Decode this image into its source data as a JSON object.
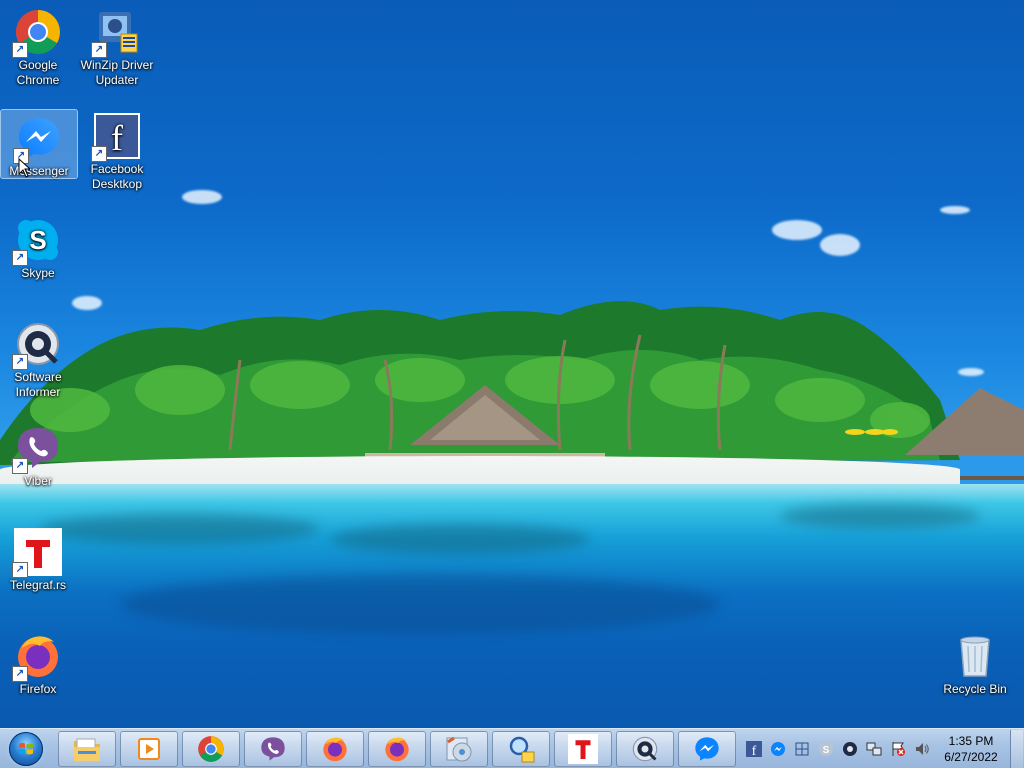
{
  "desktop": {
    "icons": [
      {
        "label_line1": "Google",
        "label_line2": "Chrome",
        "icon": "chrome-icon"
      },
      {
        "label_line1": "WinZip Driver",
        "label_line2": "Updater",
        "icon": "winzip-driver-updater-icon"
      },
      {
        "label_line1": "Messenger",
        "label_line2": "",
        "icon": "messenger-icon",
        "selected": true
      },
      {
        "label_line1": "Facebook",
        "label_line2": "Desktkop",
        "icon": "facebook-icon"
      },
      {
        "label_line1": "Skype",
        "label_line2": "",
        "icon": "skype-icon"
      },
      {
        "label_line1": "Software",
        "label_line2": "Informer",
        "icon": "software-informer-icon"
      },
      {
        "label_line1": "Viber",
        "label_line2": "",
        "icon": "viber-icon"
      },
      {
        "label_line1": "Telegraf.rs",
        "label_line2": "",
        "icon": "telegraf-icon"
      },
      {
        "label_line1": "Firefox",
        "label_line2": "",
        "icon": "firefox-icon"
      },
      {
        "label_line1": "Recycle Bin",
        "label_line2": "",
        "icon": "recycle-bin-icon"
      }
    ]
  },
  "taskbar": {
    "pinned": [
      {
        "name": "file-explorer-icon"
      },
      {
        "name": "media-player-icon"
      },
      {
        "name": "chrome-icon"
      },
      {
        "name": "viber-icon"
      },
      {
        "name": "firefox-icon"
      },
      {
        "name": "firefox-icon"
      },
      {
        "name": "disc-tool-icon"
      },
      {
        "name": "driver-updater-icon"
      },
      {
        "name": "telegraf-icon"
      },
      {
        "name": "software-informer-icon"
      },
      {
        "name": "messenger-icon"
      }
    ],
    "tray": {
      "icons": [
        "facebook-icon",
        "messenger-icon",
        "network-tool-icon",
        "skype-icon",
        "software-informer-icon",
        "network-icon",
        "flag-icon",
        "volume-icon"
      ],
      "time": "1:35 PM",
      "date": "6/27/2022"
    }
  },
  "colors": {
    "taskbar": "#a8c3e4",
    "selection": "#bedcff"
  }
}
